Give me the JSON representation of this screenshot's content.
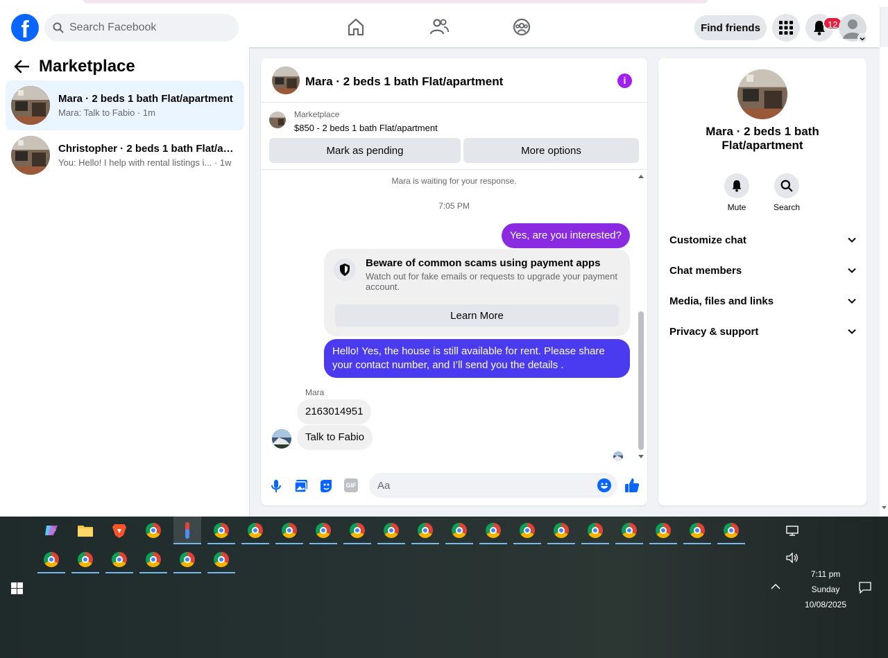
{
  "header": {
    "logo_letter": "f",
    "search_placeholder": "Search Facebook",
    "find_friends_label": "Find friends",
    "notification_count": "12"
  },
  "sidebar": {
    "title": "Marketplace",
    "conversations": [
      {
        "title": "Mara · 2 beds 1 bath Flat/apartment",
        "snippet": "Mara: Talk to Fabio · 1m",
        "active": true
      },
      {
        "title": "Christopher · 2 beds 1 bath Flat/ap...",
        "snippet": "You: Hello! I help with rental listings i... · 1w",
        "active": false
      }
    ]
  },
  "chat": {
    "title": "Mara · 2 beds 1 bath Flat/apartment",
    "listing_label": "Marketplace",
    "listing_price": "$850 - 2 beds 1 bath Flat/apartment",
    "mark_pending_label": "Mark as pending",
    "more_options_label": "More options",
    "waiting_text": "Mara is waiting for your response.",
    "timestamp": "7:05 PM",
    "msg_out_1": "Yes, are you interested?",
    "scam_title": "Beware of common scams using payment apps",
    "scam_desc": "Watch out for fake emails or requests to upgrade your payment account.",
    "learn_more_label": "Learn More",
    "msg_out_2": "Hello! Yes, the house is still available for rent. Please share your contact number, and I’ll send you the details .",
    "sender_name": "Mara",
    "msg_in_1": "2163014951",
    "msg_in_2": "Talk to Fabio",
    "composer_placeholder": "Aa",
    "gif_label": "GIF"
  },
  "details": {
    "name": "Mara · 2 beds 1 bath Flat/apartment",
    "mute_label": "Mute",
    "search_label": "Search",
    "sections": [
      "Customize chat",
      "Chat members",
      "Media, files and links",
      "Privacy & support"
    ]
  },
  "taskbar": {
    "time": "7:11 pm",
    "day": "Sunday",
    "date": "10/08/2025"
  },
  "colors": {
    "brand": "#0866ff",
    "outgoing_bubble": "#8a2be2",
    "outgoing_bubble_2": "#4a3af0",
    "info_icon": "#a020f0",
    "badge": "#e41e3f"
  }
}
